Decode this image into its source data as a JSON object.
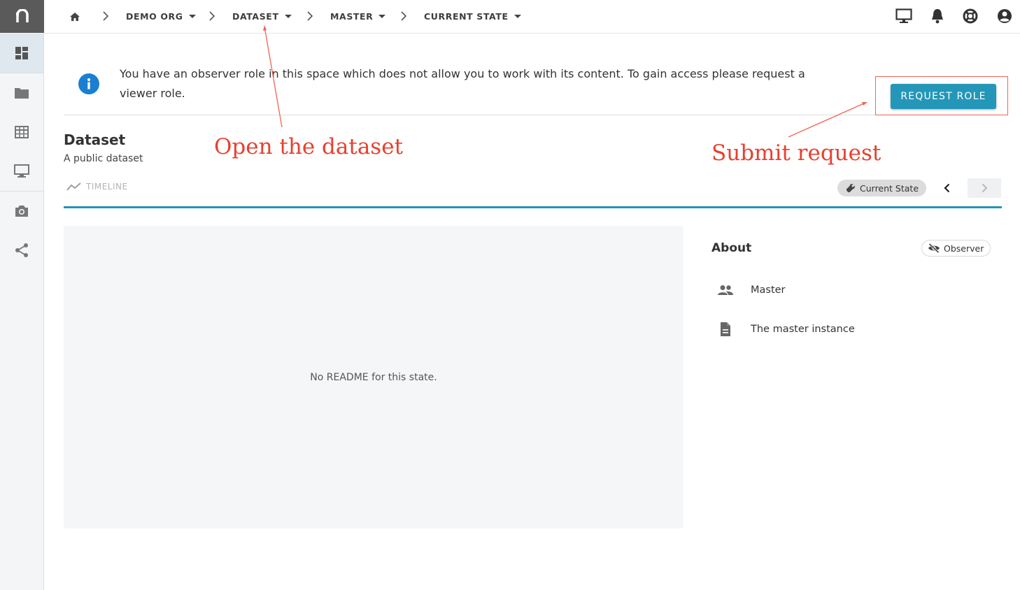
{
  "sidebar": {
    "logo": "n",
    "items": [
      {
        "icon": "dashboard-icon"
      },
      {
        "icon": "folder-icon"
      },
      {
        "icon": "table-icon"
      },
      {
        "icon": "monitor-icon"
      },
      {
        "icon": "camera-icon"
      },
      {
        "icon": "share-icon"
      }
    ]
  },
  "breadcrumb": {
    "items": [
      {
        "label": "DEMO ORG"
      },
      {
        "label": "DATASET"
      },
      {
        "label": "MASTER"
      },
      {
        "label": "CURRENT STATE"
      }
    ]
  },
  "banner": {
    "text": "You have an observer role in this space which does not allow you to work with its content. To gain access please request a viewer role.",
    "button_label": "REQUEST ROLE"
  },
  "annotations": {
    "open_dataset": "Open the dataset",
    "submit_request": "Submit request",
    "color": "#e8402f"
  },
  "dataset": {
    "title": "Dataset",
    "subtitle": "A public dataset",
    "timeline_label": "TIMELINE",
    "state_chip": "Current State"
  },
  "readme": {
    "empty_text": "No README for this state."
  },
  "about": {
    "title": "About",
    "role_chip": "Observer",
    "rows": [
      {
        "icon": "people-icon",
        "label": "Master"
      },
      {
        "icon": "document-icon",
        "label": "The master instance"
      }
    ]
  },
  "colors": {
    "accent": "#2497b8",
    "info": "#1a7fd0"
  }
}
